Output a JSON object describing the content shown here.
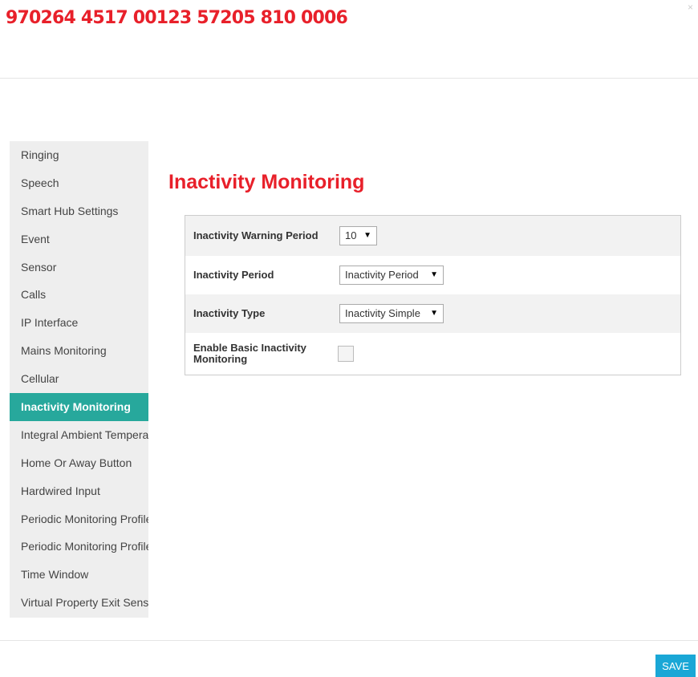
{
  "header": {
    "title": "970264 4517 00123 57205 810 0006",
    "close_label": "×"
  },
  "sidebar": {
    "items": [
      {
        "label": "Ringing"
      },
      {
        "label": "Speech"
      },
      {
        "label": "Smart Hub Settings"
      },
      {
        "label": "Event"
      },
      {
        "label": "Sensor"
      },
      {
        "label": "Calls"
      },
      {
        "label": "IP Interface"
      },
      {
        "label": "Mains Monitoring"
      },
      {
        "label": "Cellular"
      },
      {
        "label": "Inactivity Monitoring",
        "active": true
      },
      {
        "label": "Integral Ambient Temperature"
      },
      {
        "label": "Home Or Away Button"
      },
      {
        "label": "Hardwired Input"
      },
      {
        "label": "Periodic Monitoring Profile"
      },
      {
        "label": "Periodic Monitoring Profile"
      },
      {
        "label": "Time Window"
      },
      {
        "label": "Virtual Property Exit Sensor"
      }
    ]
  },
  "main": {
    "title": "Inactivity Monitoring",
    "fields": {
      "warning_period": {
        "label": "Inactivity Warning Period",
        "value": "10"
      },
      "period": {
        "label": "Inactivity Period",
        "value": "Inactivity Period"
      },
      "type": {
        "label": "Inactivity Type",
        "value": "Inactivity Simple"
      },
      "basic": {
        "label": "Enable Basic Inactivity Monitoring",
        "checked": false
      }
    },
    "select_arrow": "▼"
  },
  "footer": {
    "save_label": "SAVE"
  },
  "colors": {
    "title_red": "#e8202a",
    "active_teal": "#27a89c",
    "save_blue": "#1aa7d6"
  }
}
